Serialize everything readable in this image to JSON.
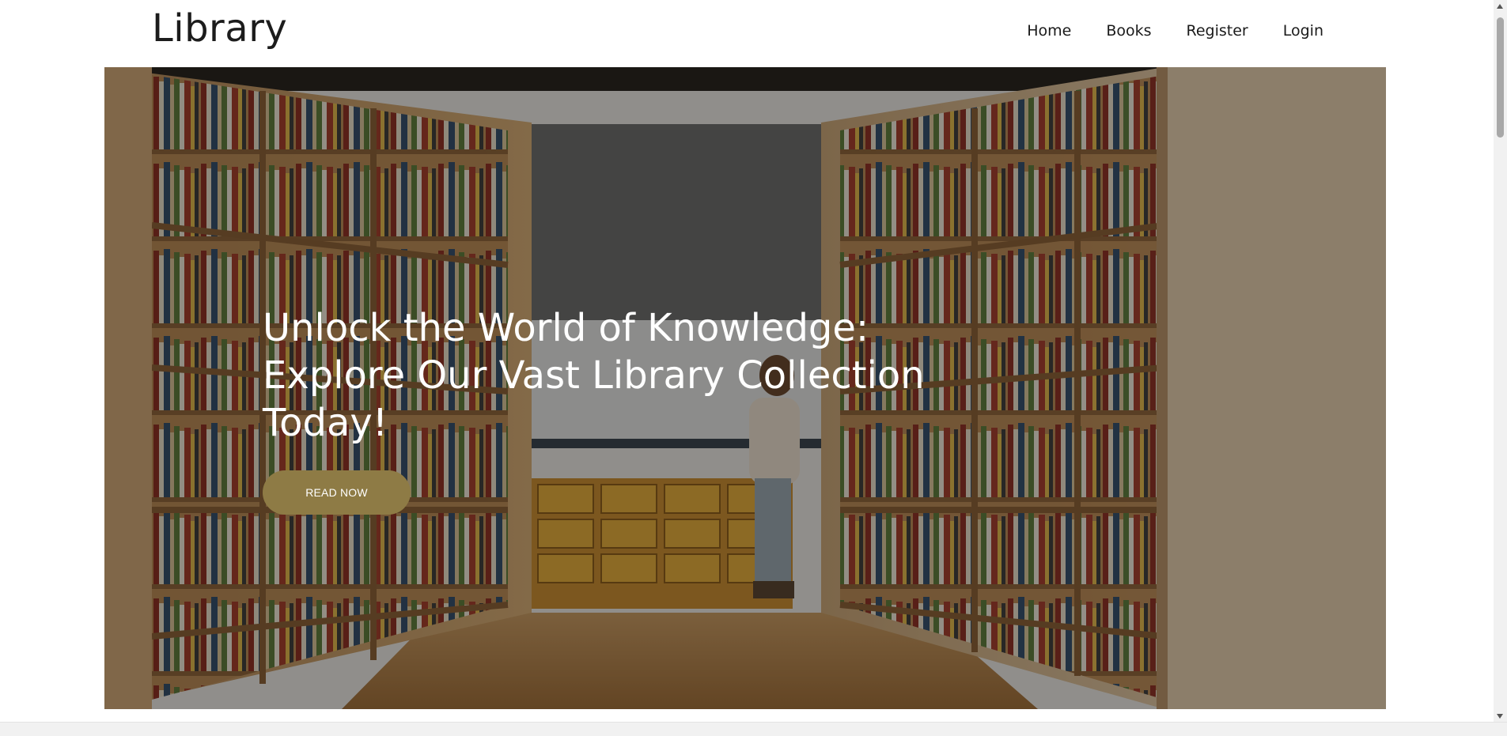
{
  "header": {
    "brand": "Library",
    "nav": [
      {
        "label": "Home"
      },
      {
        "label": "Books"
      },
      {
        "label": "Register"
      },
      {
        "label": "Login"
      }
    ]
  },
  "hero": {
    "title": "Unlock the World of Knowledge: Explore Our Vast Library Collection Today!",
    "cta_label": "READ NOW",
    "image": "library-aisle-bookshelves"
  },
  "colors": {
    "cta_background": "#8e7b45",
    "text_dark": "#1c1c1c",
    "hero_text": "#ffffff"
  }
}
